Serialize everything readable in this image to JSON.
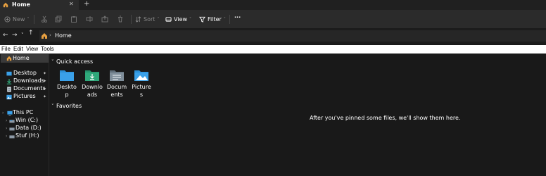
{
  "tab": {
    "title": "Home",
    "close_glyph": "✕",
    "new_tab_glyph": "+"
  },
  "toolbar": {
    "new_label": "New",
    "sort_label": "Sort",
    "view_label": "View",
    "filter_label": "Filter",
    "more_glyph": "···",
    "chevron_glyph": "˅"
  },
  "nav": {
    "back_glyph": "←",
    "forward_glyph": "→",
    "recent_glyph": "˅",
    "up_glyph": "↑"
  },
  "address": {
    "chevron_glyph": "›",
    "location": "Home"
  },
  "menubar": {
    "items": [
      "File",
      "Edit",
      "View",
      "Tools"
    ]
  },
  "sidebar": {
    "home_label": "Home",
    "pinned": [
      {
        "label": "Desktop",
        "icon": "desktop-icon"
      },
      {
        "label": "Downloads",
        "icon": "downloads-icon"
      },
      {
        "label": "Documents",
        "icon": "documents-icon"
      },
      {
        "label": "Pictures",
        "icon": "pictures-icon"
      }
    ],
    "pin_glyph": "📌",
    "this_pc_label": "This PC",
    "drives": [
      {
        "label": "Win (C:)",
        "icon": "drive-icon"
      },
      {
        "label": "Data (D:)",
        "icon": "drive-icon"
      },
      {
        "label": "Stuf (H:)",
        "icon": "drive-icon"
      }
    ]
  },
  "main": {
    "quick_access_label": "Quick access",
    "favorites_label": "Favorites",
    "folders": [
      {
        "label": "Desktop",
        "icon": "desktop-folder-icon"
      },
      {
        "label": "Downloads",
        "icon": "downloads-folder-icon"
      },
      {
        "label": "Documents",
        "icon": "documents-folder-icon"
      },
      {
        "label": "Pictures",
        "icon": "pictures-folder-icon"
      }
    ],
    "empty_message": "After you've pinned some files, we'll show them here."
  },
  "colors": {
    "background": "#191919",
    "toolbar": "#2b2b2b",
    "folder_blue": "#3aa0e8",
    "folder_green": "#2fa87a",
    "menubar": "#ffffff"
  }
}
